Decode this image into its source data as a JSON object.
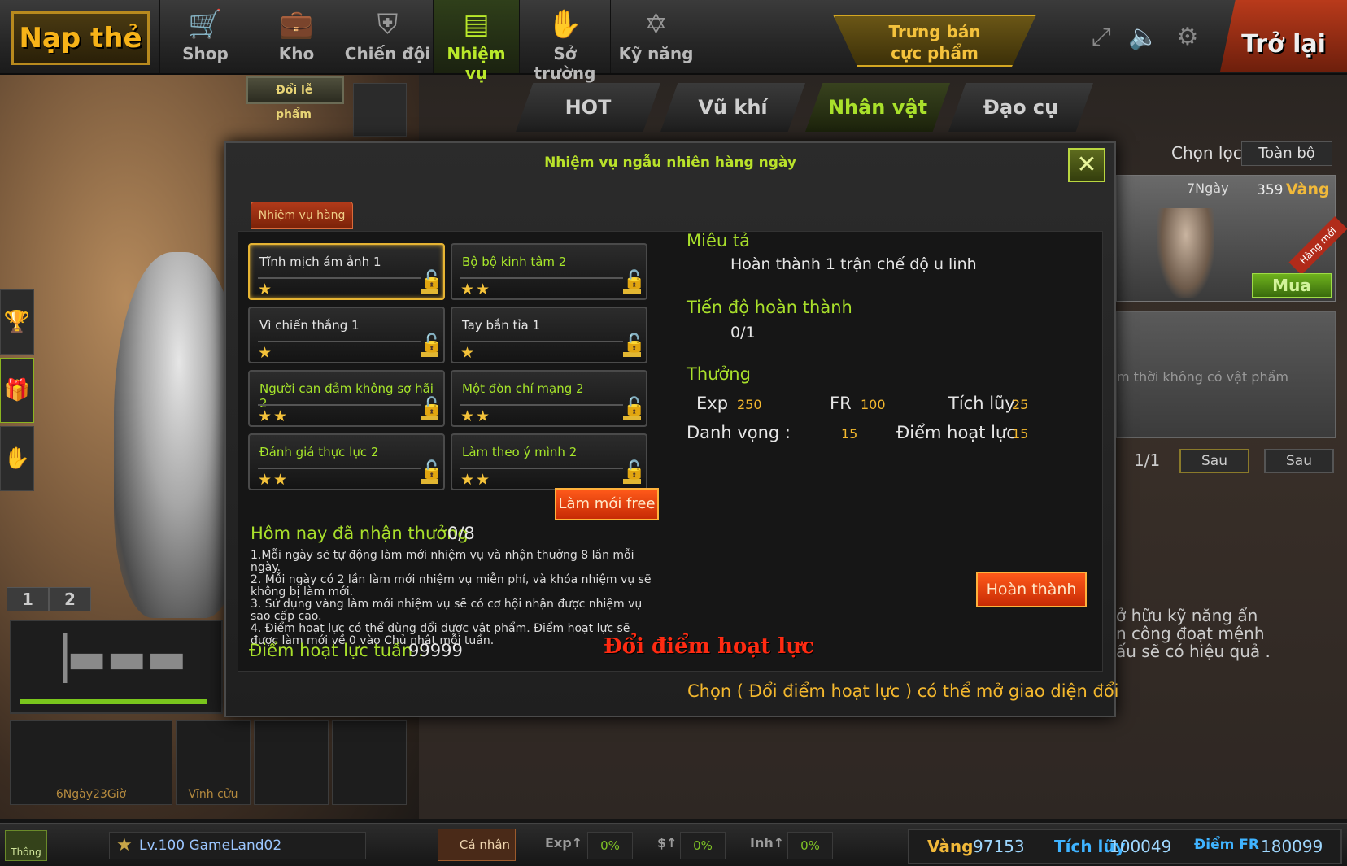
{
  "topbar": {
    "nap_the": "Nạp thẻ",
    "nav": [
      {
        "label": "Shop",
        "icon": "cart-icon"
      },
      {
        "label": "Kho",
        "icon": "briefcase-icon"
      },
      {
        "label": "Chiến đội",
        "icon": "shield-icon"
      },
      {
        "label": "Nhiệm vụ",
        "icon": "list-icon"
      },
      {
        "label": "Sở trường",
        "icon": "arm-icon"
      },
      {
        "label": "Kỹ năng",
        "icon": "star-icon"
      }
    ],
    "special_line1": "Trưng bán",
    "special_line2": "cực phẩm",
    "back": "Trở lại"
  },
  "left": {
    "doi_le_pham": "Đổi lễ phẩm",
    "page_tabs": [
      "1",
      "2"
    ],
    "slots": [
      "6Ngày23Giờ",
      "Vĩnh cửu",
      "",
      ""
    ]
  },
  "shop": {
    "tabs": [
      "HOT",
      "Vũ khí",
      "Nhân vật",
      "Đạo cụ"
    ],
    "filter_label": "Chọn lọc",
    "filter_value": "Toàn bộ",
    "item": {
      "days": "7Ngày",
      "price": "359",
      "currency": "Vàng",
      "ribbon": "Hàng mới",
      "buy": "Mua"
    },
    "empty_text": "m thời không có vật phẩm",
    "page": "1/1",
    "next1": "Sau",
    "next2": "Sau",
    "skill_text": "ở hữu kỹ năng ẩn\nn công đoạt mệnh\nấu sẽ có hiệu quả ."
  },
  "modal": {
    "title": "Nhiệm vụ ngẫu nhiên hàng ngày",
    "close": "✕",
    "tab": "Nhiệm vụ hàng ngày",
    "quests": [
      {
        "name": "Tĩnh mịch ám ảnh 1",
        "stars": "★",
        "green": false,
        "selected": true
      },
      {
        "name": "Bộ bộ kinh tâm 2",
        "stars": "★★",
        "green": true,
        "selected": false
      },
      {
        "name": "Vì chiến thắng 1",
        "stars": "★",
        "green": false,
        "selected": false
      },
      {
        "name": "Tay bắn tỉa 1",
        "stars": "★",
        "green": false,
        "selected": false
      },
      {
        "name": "Người can đảm không sợ hãi 2",
        "stars": "★★",
        "green": true,
        "selected": false
      },
      {
        "name": "Một đòn chí mạng 2",
        "stars": "★★",
        "green": true,
        "selected": false
      },
      {
        "name": "Đánh giá thực lực 2",
        "stars": "★★",
        "green": true,
        "selected": false
      },
      {
        "name": "Làm theo ý mình 2",
        "stars": "★★",
        "green": true,
        "selected": false
      }
    ],
    "today_label": "Hôm nay đã nhận thưởng",
    "today_value": "0/8",
    "refresh": "Làm mới free",
    "rules": [
      "1.Mỗi ngày sẽ tự động làm mới nhiệm vụ và nhận thưởng 8 lần mỗi ngày.",
      "2. Mỗi ngày có 2 lần làm mới nhiệm vụ miễn phí, và khóa nhiệm vụ sẽ không bị làm mới.",
      "3. Sử dụng vàng làm mới nhiệm vụ sẽ có cơ hội nhận được nhiệm vụ sao cấp cao.",
      "4. Điểm hoạt lực có thể dùng đổi được vật phẩm. Điểm hoạt lực sẽ được làm mới về 0 vào Chủ nhật mỗi tuần."
    ],
    "week_label": "Điểm hoạt lực tuần :",
    "week_value": "99999",
    "exchange": "Đổi điểm hoạt lực",
    "desc_title": "Miêu tả",
    "desc_text": "Hoàn thành 1 trận chế độ u linh",
    "progress_title": "Tiến độ hoàn thành",
    "progress_value": "0/1",
    "reward_title": "Thưởng",
    "rewards": {
      "exp_label": "Exp",
      "exp": "250",
      "fr_label": "FR",
      "fr": "100",
      "tichluy_label": "Tích lũy",
      "tichluy": "25",
      "danhvong_label": "Danh vọng :",
      "danhvong": "15",
      "hoatluc_label": "Điểm hoạt lực",
      "hoatluc": "15"
    },
    "complete": "Hoàn thành",
    "hint": "Chọn ( Đổi điểm hoạt lực ) có thể mở giao diện đổi"
  },
  "bottombar": {
    "notice": "Thông báo",
    "level": "Lv.100 GameLand02",
    "ca_nhan": "Cá nhân",
    "exp_label": "Exp↑",
    "exp": "0%",
    "money_label": "$↑",
    "money": "0%",
    "inh_label": "Inh↑",
    "inh": "0%",
    "vang_label": "Vàng",
    "vang": "97153",
    "tichluy_label": "Tích lũy",
    "tichluy": "100049",
    "diemfr_label": "Điểm FR",
    "diemfr": "180099"
  },
  "colors": {
    "accent_green": "#a9e02b",
    "gold": "#f4b82e",
    "red_button": "#e8420f"
  }
}
